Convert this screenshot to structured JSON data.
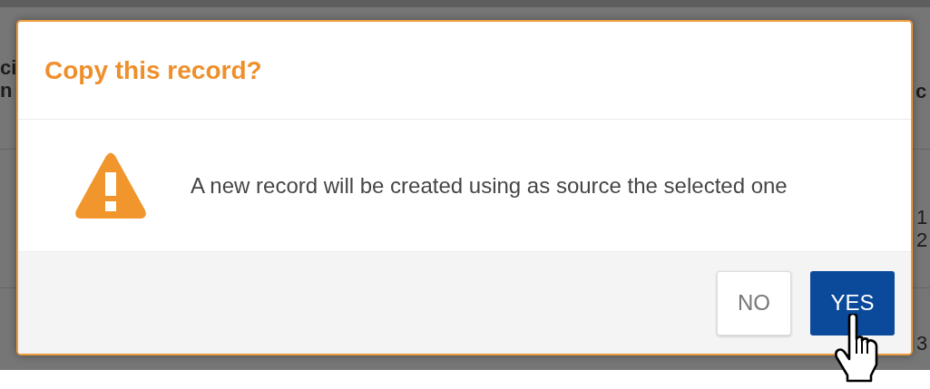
{
  "background_table": {
    "column_1_heading": [
      "ci",
      "n"
    ],
    "column_6_heading": "c",
    "rows": [
      {
        "column_6": [
          "1",
          "2"
        ]
      },
      {
        "column_6": [
          "3"
        ]
      }
    ]
  },
  "dialog": {
    "title": "Copy this record?",
    "message": "A new record will be created using as source the selected one",
    "buttons": [
      {
        "label": "NO",
        "kind": "secondary"
      },
      {
        "label": "YES",
        "kind": "primary"
      }
    ]
  }
}
